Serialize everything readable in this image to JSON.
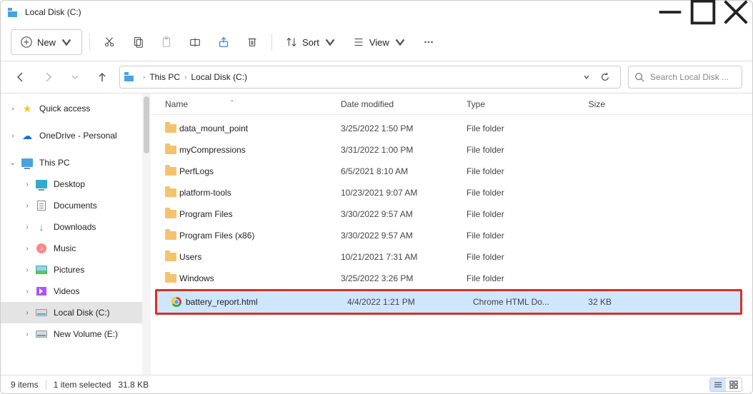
{
  "window": {
    "title": "Local Disk (C:)"
  },
  "toolbar": {
    "new_label": "New",
    "sort_label": "Sort",
    "view_label": "View"
  },
  "breadcrumb": {
    "items": [
      "This PC",
      "Local Disk (C:)"
    ]
  },
  "search": {
    "placeholder": "Search Local Disk ..."
  },
  "sidebar": {
    "quick_access": "Quick access",
    "onedrive": "OneDrive - Personal",
    "this_pc": "This PC",
    "desktop": "Desktop",
    "documents": "Documents",
    "downloads": "Downloads",
    "music": "Music",
    "pictures": "Pictures",
    "videos": "Videos",
    "local_disk": "Local Disk (C:)",
    "new_volume": "New Volume (E:)"
  },
  "columns": {
    "name": "Name",
    "date": "Date modified",
    "type": "Type",
    "size": "Size"
  },
  "rows": [
    {
      "name": "data_mount_point",
      "date": "3/25/2022 1:50 PM",
      "type": "File folder",
      "size": "",
      "kind": "folder"
    },
    {
      "name": "myCompressions",
      "date": "3/31/2022 1:00 PM",
      "type": "File folder",
      "size": "",
      "kind": "folder"
    },
    {
      "name": "PerfLogs",
      "date": "6/5/2021 8:10 AM",
      "type": "File folder",
      "size": "",
      "kind": "folder"
    },
    {
      "name": "platform-tools",
      "date": "10/23/2021 9:07 AM",
      "type": "File folder",
      "size": "",
      "kind": "folder"
    },
    {
      "name": "Program Files",
      "date": "3/30/2022 9:57 AM",
      "type": "File folder",
      "size": "",
      "kind": "folder"
    },
    {
      "name": "Program Files (x86)",
      "date": "3/30/2022 9:57 AM",
      "type": "File folder",
      "size": "",
      "kind": "folder"
    },
    {
      "name": "Users",
      "date": "10/21/2021 7:31 AM",
      "type": "File folder",
      "size": "",
      "kind": "folder"
    },
    {
      "name": "Windows",
      "date": "3/25/2022 3:26 PM",
      "type": "File folder",
      "size": "",
      "kind": "folder"
    },
    {
      "name": "battery_report.html",
      "date": "4/4/2022 1:21 PM",
      "type": "Chrome HTML Do...",
      "size": "32 KB",
      "kind": "chrome",
      "selected": true,
      "highlighted": true
    }
  ],
  "status": {
    "items": "9 items",
    "selection": "1 item selected",
    "sel_size": "31.8 KB"
  }
}
